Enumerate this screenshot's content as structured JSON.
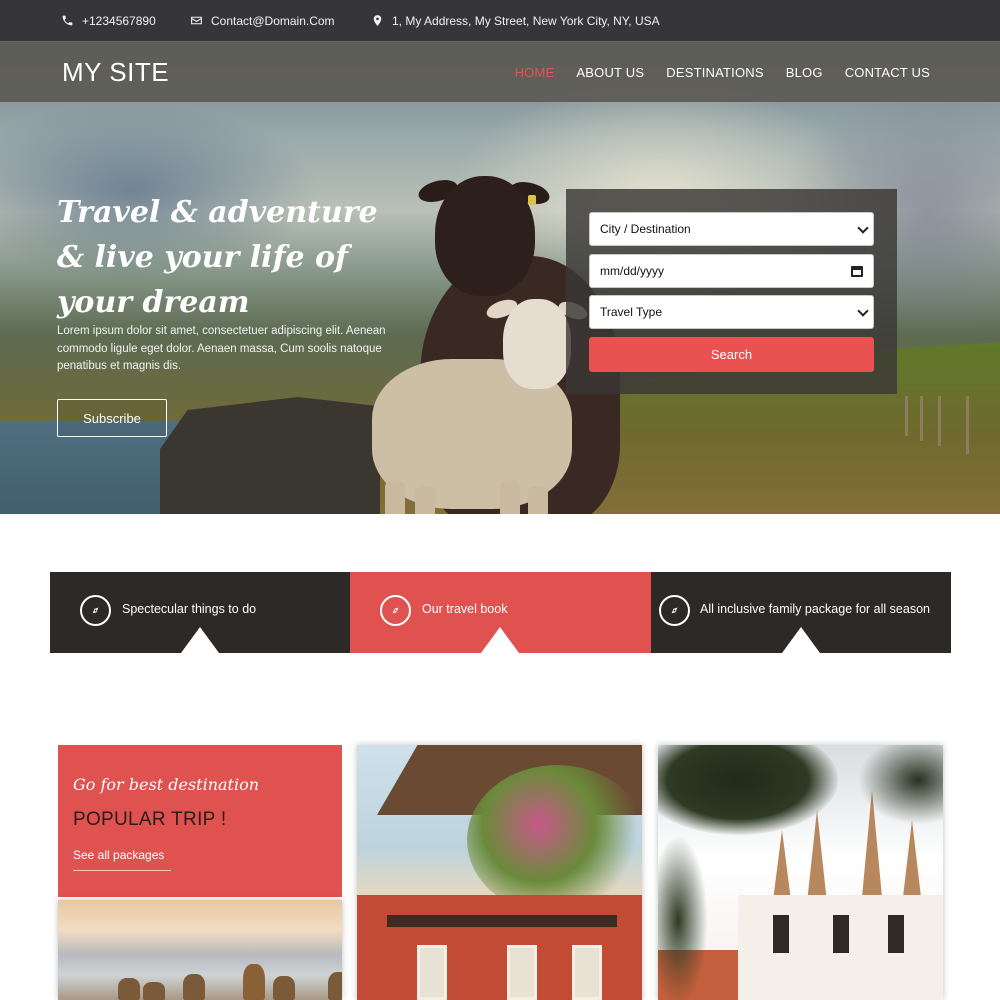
{
  "topbar": {
    "phone": "+1234567890",
    "email": "Contact@Domain.Com",
    "address": "1, My Address, My Street, New York City, NY, USA"
  },
  "header": {
    "logo": "MY SITE",
    "nav": [
      "HOME",
      "ABOUT US",
      "DESTINATIONS",
      "BLOG",
      "CONTACT US"
    ],
    "active_nav": "HOME"
  },
  "hero": {
    "title_line1": "Travel & adventure",
    "title_line2": "& live your life of",
    "title_line3": "your dream",
    "text": "Lorem ipsum dolor sit amet, consectetuer adipiscing elit. Aenean commodo ligule eget dolor. Aenaen massa, Cum soolis natoque penatibus et magnis dis.",
    "subscribe_label": "Subscribe"
  },
  "search": {
    "destination_value": "City / Destination",
    "date_placeholder": "mm/dd/yyyy",
    "travel_type_value": "Travel Type",
    "search_label": "Search"
  },
  "features": [
    {
      "label": "Spectecular things to do"
    },
    {
      "label": "Our travel book"
    },
    {
      "label": "All inclusive family package for all season"
    }
  ],
  "popular": {
    "tagline": "Go for best destination",
    "title": "POPULAR TRIP !",
    "link_label": "See all packages"
  },
  "colors": {
    "accent": "#df5250",
    "dark": "#2d2926",
    "topbar": "#36363a"
  },
  "icons": {
    "phone": "phone-icon",
    "email": "envelope-icon",
    "address": "map-pin-icon",
    "feature": "compass-icon"
  }
}
